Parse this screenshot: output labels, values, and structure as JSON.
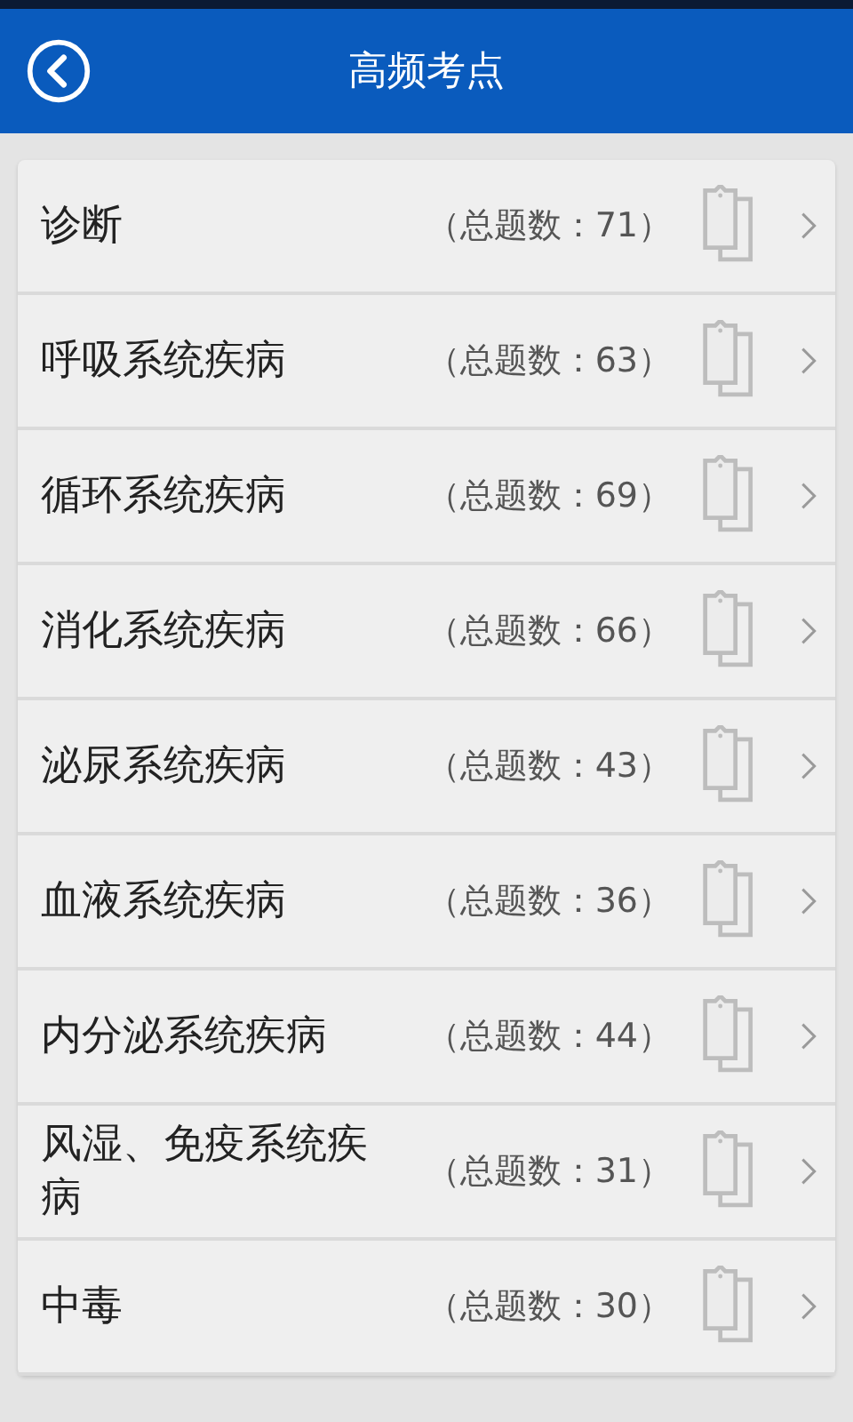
{
  "header": {
    "title": "高频考点"
  },
  "items": [
    {
      "name": "诊断",
      "count": "（总题数：71）"
    },
    {
      "name": "呼吸系统疾病",
      "count": "（总题数：63）"
    },
    {
      "name": "循环系统疾病",
      "count": "（总题数：69）"
    },
    {
      "name": "消化系统疾病",
      "count": "（总题数：66）"
    },
    {
      "name": "泌尿系统疾病",
      "count": "（总题数：43）"
    },
    {
      "name": "血液系统疾病",
      "count": "（总题数：36）"
    },
    {
      "name": "内分泌系统疾病",
      "count": "（总题数：44）"
    },
    {
      "name": "风湿、免疫系统疾病",
      "count": "（总题数：31）"
    },
    {
      "name": "中毒",
      "count": "（总题数：30）"
    }
  ]
}
